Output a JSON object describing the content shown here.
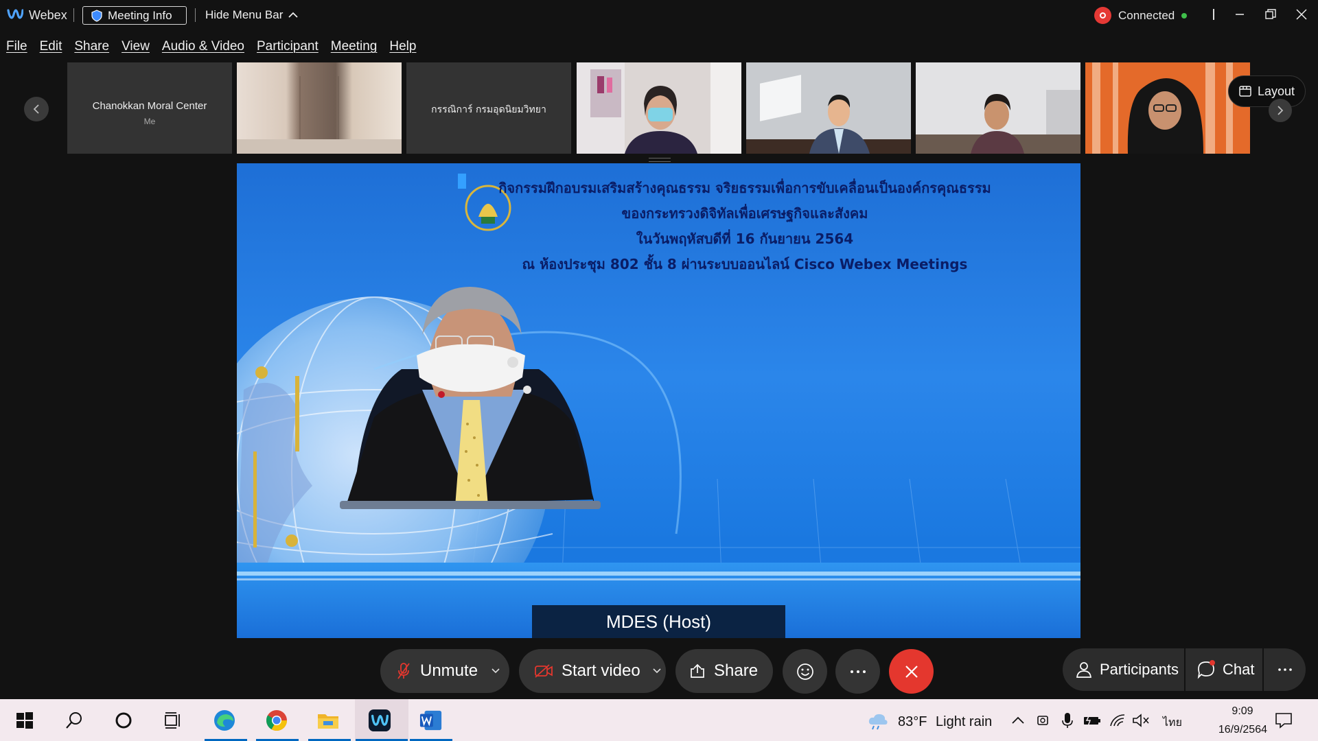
{
  "titlebar": {
    "app_name": "Webex",
    "meeting_info": "Meeting Info",
    "hide_menu_bar": "Hide Menu Bar",
    "status": "Connected"
  },
  "menu": [
    "File",
    "Edit",
    "Share",
    "View",
    "Audio & Video",
    "Participant",
    "Meeting",
    "Help"
  ],
  "filmstrip": {
    "tiles": [
      {
        "name": "Chanokkan Moral Center",
        "sub": "Me"
      },
      {
        "name": "",
        "sub": ""
      },
      {
        "name": "กรรณิการ์ กรมอุดนิยมวิทยา",
        "sub": ""
      },
      {
        "name": "",
        "sub": ""
      },
      {
        "name": "",
        "sub": ""
      },
      {
        "name": "",
        "sub": ""
      },
      {
        "name": "",
        "sub": ""
      }
    ],
    "layout_label": "Layout"
  },
  "stage": {
    "slide_lines": [
      "กิจกรรมฝึกอบรมเสริมสร้างคุณธรรม จริยธรรมเพื่อการขับเคลื่อนเป็นองค์กรคุณธรรม",
      "ของกระทรวงดิจิทัลเพื่อเศรษฐกิจและสังคม",
      "ในวันพฤหัสบดีที่ 16 กันยายน 2564",
      "ณ ห้องประชุม 802 ชั้น 8 ผ่านระบบออนไลน์ Cisco Webex Meetings"
    ],
    "host_label": "MDES (Host)"
  },
  "controls": {
    "unmute": "Unmute",
    "start_video": "Start video",
    "share": "Share",
    "participants": "Participants",
    "chat": "Chat"
  },
  "taskbar": {
    "weather_temp": "83°F",
    "weather_desc": "Light rain",
    "language": "ไทย",
    "time": "9:09",
    "date": "16/9/2564"
  },
  "colors": {
    "end_call": "#e4372e",
    "record": "#e53935",
    "connected_dot": "#3fbf4a",
    "taskbar_accent": "#0067c0"
  }
}
